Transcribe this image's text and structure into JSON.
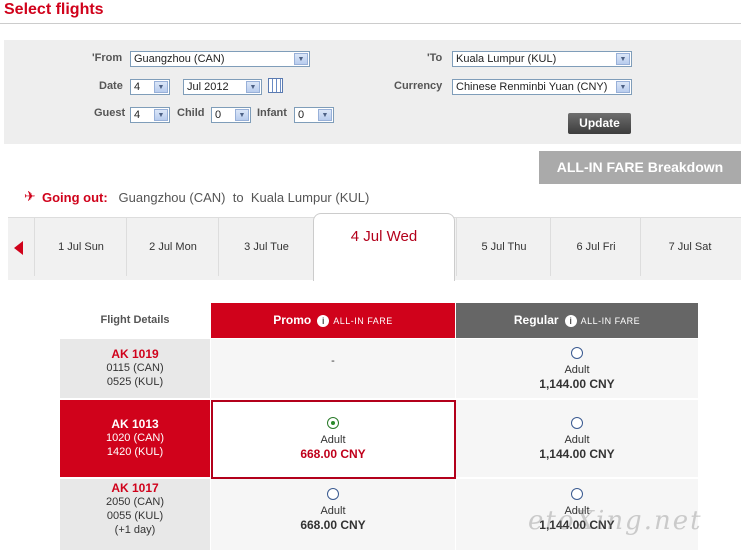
{
  "header": {
    "title": "Select flights"
  },
  "search": {
    "from_label": "'From",
    "from_value": "Guangzhou (CAN)",
    "to_label": "'To",
    "to_value": "Kuala Lumpur (KUL)",
    "date_label": "Date",
    "day_value": "4",
    "month_value": "Jul 2012",
    "currency_label": "Currency",
    "currency_value": "Chinese Renminbi Yuan (CNY)",
    "guest_label": "Guest",
    "guest_value": "4",
    "child_label": "Child",
    "child_value": "0",
    "infant_label": "Infant",
    "infant_value": "0",
    "update_label": "Update"
  },
  "breakdown_label": "ALL-IN FARE Breakdown",
  "going_out": {
    "label": "Going out:",
    "from": "Guangzhou (CAN)",
    "to_word": "to",
    "to": "Kuala Lumpur (KUL)"
  },
  "date_tabs": [
    "1 Jul Sun",
    "2 Jul Mon",
    "3 Jul Tue",
    "4 Jul Wed",
    "5 Jul Thu",
    "6 Jul Fri",
    "7 Jul Sat"
  ],
  "active_tab": "4 Jul Wed",
  "table": {
    "col_flight": "Flight Details",
    "col_promo": "Promo",
    "col_regular": "Regular",
    "fare_tag": "ALL-IN FARE",
    "rows": [
      {
        "flight": "AK 1019",
        "dep": "0115 (CAN)",
        "arr": "0525 (KUL)",
        "extra": "",
        "promo_empty": "-",
        "regular_label": "Adult",
        "regular_price": "1,144.00 CNY"
      },
      {
        "flight": "AK 1013",
        "dep": "1020 (CAN)",
        "arr": "1420 (KUL)",
        "extra": "",
        "promo_label": "Adult",
        "promo_price": "668.00 CNY",
        "regular_label": "Adult",
        "regular_price": "1,144.00 CNY"
      },
      {
        "flight": "AK 1017",
        "dep": "2050 (CAN)",
        "arr": "0055 (KUL)",
        "extra": "(+1 day)",
        "promo_label": "Adult",
        "promo_price": "668.00 CNY",
        "regular_label": "Adult",
        "regular_price": "1,144.00 CNY"
      }
    ]
  },
  "watermark": "etoXing.net",
  "colors": {
    "brand_red": "#d0021b",
    "regular_grey": "#666666"
  }
}
